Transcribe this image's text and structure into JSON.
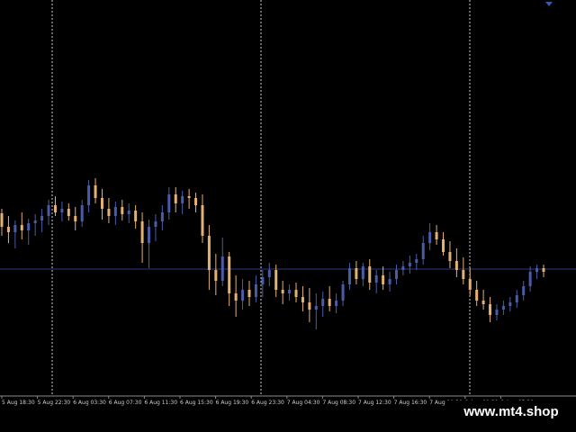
{
  "chart_data": {
    "type": "candlestick",
    "x_labels": [
      "5 Aug 18:30",
      "5 Aug 22:30",
      "6 Aug 03:30",
      "6 Aug 07:30",
      "6 Aug 11:30",
      "6 Aug 15:30",
      "6 Aug 19:30",
      "6 Aug 23:30",
      "7 Aug 04:30",
      "7 Aug 08:30",
      "7 Aug 12:30",
      "7 Aug 16:30",
      "7 Aug 20:30",
      "8 Aug 01:30",
      "8 Aug 05:30"
    ],
    "vertical_gridlines": 3,
    "price_line": "horizontal",
    "grid": true,
    "series_color_up": "#4a5ca8",
    "series_color_down": "#e6b070",
    "price_line_color": "#2c3a8a",
    "axis_color": "#8a8a8a",
    "background": "#000000",
    "candles": [
      {
        "o": 237,
        "h": 232,
        "l": 262,
        "c": 252
      },
      {
        "o": 252,
        "h": 240,
        "l": 270,
        "c": 258
      },
      {
        "o": 258,
        "h": 245,
        "l": 276,
        "c": 250
      },
      {
        "o": 250,
        "h": 236,
        "l": 266,
        "c": 256
      },
      {
        "o": 256,
        "h": 243,
        "l": 272,
        "c": 248
      },
      {
        "o": 248,
        "h": 238,
        "l": 262,
        "c": 245
      },
      {
        "o": 245,
        "h": 232,
        "l": 258,
        "c": 240
      },
      {
        "o": 240,
        "h": 222,
        "l": 250,
        "c": 228
      },
      {
        "o": 228,
        "h": 218,
        "l": 240,
        "c": 236
      },
      {
        "o": 236,
        "h": 224,
        "l": 246,
        "c": 232
      },
      {
        "o": 232,
        "h": 226,
        "l": 245,
        "c": 240
      },
      {
        "o": 240,
        "h": 230,
        "l": 256,
        "c": 246
      },
      {
        "o": 246,
        "h": 222,
        "l": 252,
        "c": 228
      },
      {
        "o": 228,
        "h": 200,
        "l": 236,
        "c": 206
      },
      {
        "o": 206,
        "h": 198,
        "l": 226,
        "c": 220
      },
      {
        "o": 220,
        "h": 210,
        "l": 244,
        "c": 232
      },
      {
        "o": 232,
        "h": 220,
        "l": 248,
        "c": 240
      },
      {
        "o": 240,
        "h": 224,
        "l": 250,
        "c": 230
      },
      {
        "o": 230,
        "h": 222,
        "l": 245,
        "c": 238
      },
      {
        "o": 238,
        "h": 226,
        "l": 248,
        "c": 234
      },
      {
        "o": 234,
        "h": 228,
        "l": 254,
        "c": 246
      },
      {
        "o": 246,
        "h": 236,
        "l": 292,
        "c": 270
      },
      {
        "o": 270,
        "h": 244,
        "l": 298,
        "c": 252
      },
      {
        "o": 252,
        "h": 238,
        "l": 268,
        "c": 246
      },
      {
        "o": 246,
        "h": 228,
        "l": 256,
        "c": 236
      },
      {
        "o": 236,
        "h": 208,
        "l": 244,
        "c": 216
      },
      {
        "o": 216,
        "h": 208,
        "l": 236,
        "c": 226
      },
      {
        "o": 226,
        "h": 212,
        "l": 238,
        "c": 218
      },
      {
        "o": 218,
        "h": 210,
        "l": 232,
        "c": 220
      },
      {
        "o": 220,
        "h": 214,
        "l": 236,
        "c": 228
      },
      {
        "o": 228,
        "h": 216,
        "l": 270,
        "c": 262
      },
      {
        "o": 262,
        "h": 250,
        "l": 322,
        "c": 300
      },
      {
        "o": 300,
        "h": 282,
        "l": 328,
        "c": 312
      },
      {
        "o": 312,
        "h": 264,
        "l": 318,
        "c": 285
      },
      {
        "o": 285,
        "h": 280,
        "l": 340,
        "c": 326
      },
      {
        "o": 326,
        "h": 306,
        "l": 352,
        "c": 334
      },
      {
        "o": 334,
        "h": 310,
        "l": 344,
        "c": 322
      },
      {
        "o": 322,
        "h": 312,
        "l": 340,
        "c": 330
      },
      {
        "o": 330,
        "h": 306,
        "l": 336,
        "c": 316
      },
      {
        "o": 316,
        "h": 300,
        "l": 330,
        "c": 308
      },
      {
        "o": 308,
        "h": 292,
        "l": 318,
        "c": 300
      },
      {
        "o": 300,
        "h": 294,
        "l": 330,
        "c": 322
      },
      {
        "o": 322,
        "h": 312,
        "l": 338,
        "c": 326
      },
      {
        "o": 326,
        "h": 316,
        "l": 334,
        "c": 322
      },
      {
        "o": 322,
        "h": 314,
        "l": 336,
        "c": 330
      },
      {
        "o": 330,
        "h": 318,
        "l": 346,
        "c": 336
      },
      {
        "o": 336,
        "h": 320,
        "l": 358,
        "c": 344
      },
      {
        "o": 344,
        "h": 326,
        "l": 366,
        "c": 340
      },
      {
        "o": 340,
        "h": 324,
        "l": 352,
        "c": 332
      },
      {
        "o": 332,
        "h": 318,
        "l": 346,
        "c": 340
      },
      {
        "o": 340,
        "h": 326,
        "l": 348,
        "c": 334
      },
      {
        "o": 334,
        "h": 312,
        "l": 340,
        "c": 316
      },
      {
        "o": 316,
        "h": 292,
        "l": 322,
        "c": 298
      },
      {
        "o": 298,
        "h": 290,
        "l": 316,
        "c": 310
      },
      {
        "o": 310,
        "h": 292,
        "l": 318,
        "c": 296
      },
      {
        "o": 296,
        "h": 288,
        "l": 322,
        "c": 314
      },
      {
        "o": 314,
        "h": 300,
        "l": 326,
        "c": 306
      },
      {
        "o": 306,
        "h": 296,
        "l": 322,
        "c": 316
      },
      {
        "o": 316,
        "h": 302,
        "l": 324,
        "c": 310
      },
      {
        "o": 310,
        "h": 294,
        "l": 316,
        "c": 300
      },
      {
        "o": 300,
        "h": 290,
        "l": 306,
        "c": 296
      },
      {
        "o": 296,
        "h": 284,
        "l": 304,
        "c": 292
      },
      {
        "o": 292,
        "h": 282,
        "l": 300,
        "c": 288
      },
      {
        "o": 288,
        "h": 262,
        "l": 294,
        "c": 270
      },
      {
        "o": 270,
        "h": 248,
        "l": 278,
        "c": 258
      },
      {
        "o": 258,
        "h": 250,
        "l": 272,
        "c": 266
      },
      {
        "o": 266,
        "h": 258,
        "l": 284,
        "c": 280
      },
      {
        "o": 280,
        "h": 268,
        "l": 298,
        "c": 290
      },
      {
        "o": 290,
        "h": 276,
        "l": 308,
        "c": 300
      },
      {
        "o": 300,
        "h": 286,
        "l": 316,
        "c": 310
      },
      {
        "o": 310,
        "h": 298,
        "l": 328,
        "c": 322
      },
      {
        "o": 322,
        "h": 312,
        "l": 340,
        "c": 334
      },
      {
        "o": 334,
        "h": 322,
        "l": 344,
        "c": 338
      },
      {
        "o": 338,
        "h": 330,
        "l": 358,
        "c": 350
      },
      {
        "o": 350,
        "h": 338,
        "l": 356,
        "c": 344
      },
      {
        "o": 344,
        "h": 334,
        "l": 350,
        "c": 340
      },
      {
        "o": 340,
        "h": 330,
        "l": 346,
        "c": 336
      },
      {
        "o": 336,
        "h": 322,
        "l": 342,
        "c": 328
      },
      {
        "o": 328,
        "h": 312,
        "l": 334,
        "c": 318
      },
      {
        "o": 318,
        "h": 296,
        "l": 324,
        "c": 302
      },
      {
        "o": 302,
        "h": 294,
        "l": 310,
        "c": 298
      },
      {
        "o": 298,
        "h": 294,
        "l": 308,
        "c": 302
      }
    ]
  },
  "watermark": {
    "text": "www.mt4.shop"
  }
}
